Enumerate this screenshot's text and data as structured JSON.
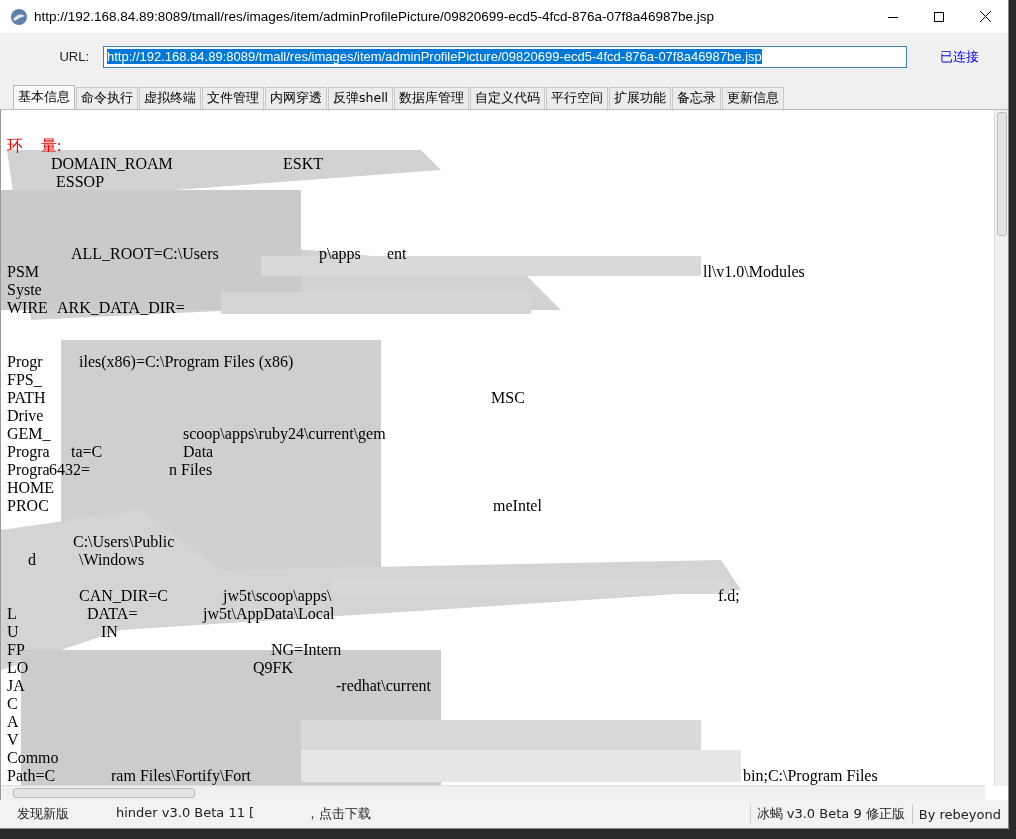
{
  "window": {
    "title": "http://192.168.84.89:8089/tmall/res/images/item/adminProfilePicture/09820699-ecd5-4fcd-876a-07f8a46987be.jsp"
  },
  "url_bar": {
    "label": "URL:",
    "value": "http://192.168.84.89:8089/tmall/res/images/item/adminProfilePicture/09820699-ecd5-4fcd-876a-07f8a46987be.jsp",
    "text_selected": true,
    "status": "已连接"
  },
  "tabs": [
    {
      "label": "基本信息",
      "selected": true
    },
    {
      "label": "命令执行",
      "selected": false
    },
    {
      "label": "虚拟终端",
      "selected": false
    },
    {
      "label": "文件管理",
      "selected": false
    },
    {
      "label": "内网穿透",
      "selected": false
    },
    {
      "label": "反弹shell",
      "selected": false
    },
    {
      "label": "数据库管理",
      "selected": false
    },
    {
      "label": "自定义代码",
      "selected": false
    },
    {
      "label": "平行空间",
      "selected": false
    },
    {
      "label": "扩展功能",
      "selected": false
    },
    {
      "label": "备忘录",
      "selected": false
    },
    {
      "label": "更新信息",
      "selected": false
    }
  ],
  "content": {
    "lines": [
      {
        "kind": "heading",
        "fragments": [
          "环",
          "量:"
        ]
      },
      {
        "kind": "text",
        "fragments": [
          "DOMAIN_ROAM",
          "ESKT"
        ]
      },
      {
        "kind": "text",
        "fragments": [
          "ESSOP"
        ]
      },
      {
        "kind": "text",
        "fragments": [
          "ALL_ROOT=C:\\Users",
          "p\\apps",
          "ent"
        ]
      },
      {
        "kind": "text",
        "fragments": [
          "PSM",
          "ll\\v1.0\\Modules"
        ]
      },
      {
        "kind": "text",
        "fragments": [
          "Syste"
        ]
      },
      {
        "kind": "text",
        "fragments": [
          "WIRE",
          "ARK_DATA_DIR="
        ]
      },
      {
        "kind": "text",
        "fragments": [
          "Progr",
          "iles(x86)=C:\\Program Files (x86)"
        ]
      },
      {
        "kind": "text",
        "fragments": [
          "FPS_"
        ]
      },
      {
        "kind": "text",
        "fragments": [
          "PATH",
          "MSC"
        ]
      },
      {
        "kind": "text",
        "fragments": [
          "Drive"
        ]
      },
      {
        "kind": "text",
        "fragments": [
          "GEM_",
          "scoop\\apps\\ruby24\\current\\gem"
        ]
      },
      {
        "kind": "text",
        "fragments": [
          "Progra",
          "ta=C",
          "Data"
        ]
      },
      {
        "kind": "text",
        "fragments": [
          "Progra",
          "6432=",
          "n Files"
        ]
      },
      {
        "kind": "text",
        "fragments": [
          "HOME"
        ]
      },
      {
        "kind": "text",
        "fragments": [
          "PROC",
          "meIntel"
        ]
      },
      {
        "kind": "text",
        "fragments": [
          "C:\\Users\\Public"
        ]
      },
      {
        "kind": "text",
        "fragments": [
          "d",
          "\\Windows"
        ]
      },
      {
        "kind": "text",
        "fragments": [
          "CAN_DIR=C",
          "jw5t\\scoop\\apps\\",
          "f.d;"
        ]
      },
      {
        "kind": "text",
        "fragments": [
          "L",
          "DATA=",
          "jw5t\\AppData\\Local"
        ]
      },
      {
        "kind": "text",
        "fragments": [
          "U",
          "IN"
        ]
      },
      {
        "kind": "text",
        "fragments": [
          "FP",
          "NG=Intern"
        ]
      },
      {
        "kind": "text",
        "fragments": [
          "LO",
          "Q9FK"
        ]
      },
      {
        "kind": "text",
        "fragments": [
          "JA",
          "-redhat\\current"
        ]
      },
      {
        "kind": "text",
        "fragments": [
          "C"
        ]
      },
      {
        "kind": "text",
        "fragments": [
          "A"
        ]
      },
      {
        "kind": "text",
        "fragments": [
          "V"
        ]
      },
      {
        "kind": "text",
        "fragments": [
          "Commo"
        ]
      },
      {
        "kind": "text",
        "fragments": [
          "Path=C",
          "ram Files\\Fortify\\Fort",
          "bin;C:\\Program Files"
        ]
      }
    ]
  },
  "status_bar": {
    "notice": [
      "发现新版",
      "hinder v3.0 Beta 11 [",
      "，点击下载"
    ],
    "version": "冰蝎 v3.0 Beta 9 修正版",
    "author": "By rebeyond"
  }
}
